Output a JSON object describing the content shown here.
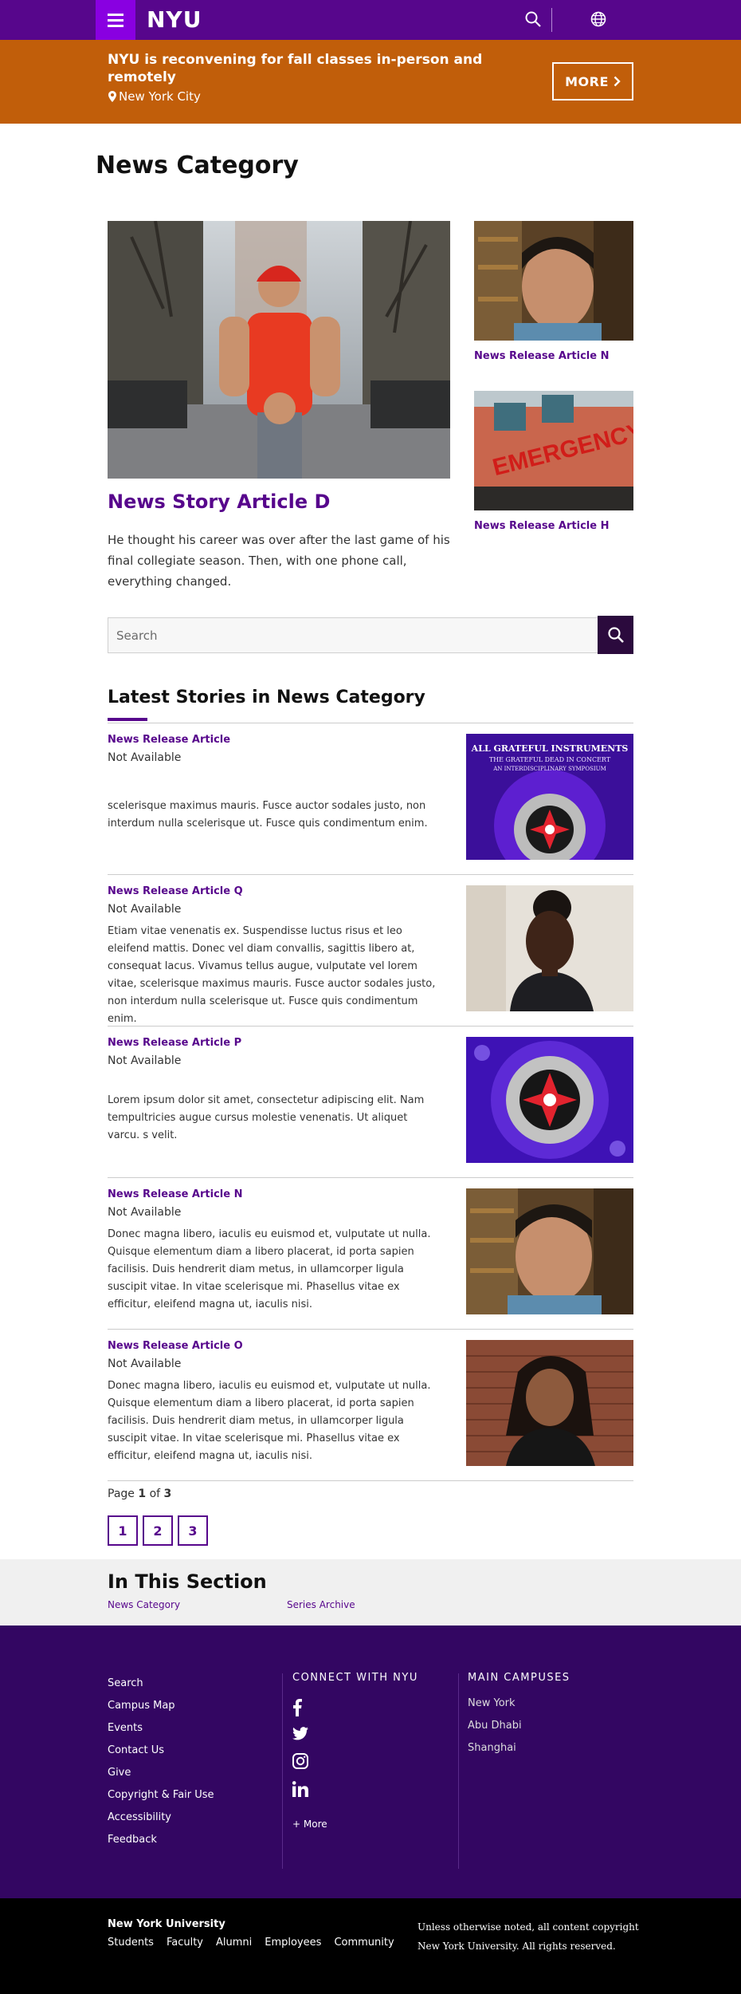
{
  "header": {
    "logo": "NYU",
    "menu_icon": "hamburger-menu-icon",
    "search_icon": "search-icon",
    "globe_icon": "globe-icon",
    "brand_color": "#57068c"
  },
  "alert": {
    "text": "NYU is reconvening for fall classes in-person and remotely",
    "location": "New York City",
    "location_icon": "map-pin-icon",
    "more_label": "MORE",
    "more_icon": "chevron-right-icon",
    "color": "#c15e0a"
  },
  "page": {
    "title": "News Category"
  },
  "featured": {
    "title": "News Story Article D",
    "description": "He thought his career was over after the last game of his final collegiate season. Then, with one phone call, everything changed."
  },
  "side_cards": [
    {
      "label": "News Release Article N"
    },
    {
      "label": "News Release Article H"
    }
  ],
  "search": {
    "placeholder": "Search",
    "button_icon": "search-icon"
  },
  "latest": {
    "heading": "Latest Stories in News Category",
    "stories": [
      {
        "title": "News Release Article",
        "date": "Not Available",
        "description": "scelerisque maximus mauris. Fusce auctor sodales justo, non interdum nulla scelerisque ut. Fusce quis condimentum enim."
      },
      {
        "title": "News Release Article Q",
        "date": "Not Available",
        "description": "Etiam vitae venenatis ex. Suspendisse luctus risus et leo eleifend mattis. Donec vel diam convallis, sagittis libero at, consequat lacus. Vivamus tellus augue, vulputate vel lorem vitae, scelerisque maximus mauris. Fusce auctor sodales justo, non interdum nulla scelerisque ut. Fusce quis condimentum enim."
      },
      {
        "title": "News Release Article P",
        "date": "Not Available",
        "description": "Lorem ipsum dolor sit amet, consectetur adipiscing elit. Nam tempultricies augue cursus molestie venenatis. Ut aliquet varcu. s velit."
      },
      {
        "title": "News Release Article N",
        "date": "Not Available",
        "description": "Donec magna libero, iaculis eu euismod et, vulputate ut nulla. Quisque elementum diam a libero placerat, id porta sapien facilisis. Duis hendrerit diam metus, in ullamcorper ligula suscipit vitae. In vitae scelerisque mi. Phasellus vitae ex efficitur, eleifend magna ut, iaculis nisi."
      },
      {
        "title": "News Release Article O",
        "date": "Not Available",
        "description": "Donec magna libero, iaculis eu euismod et, vulputate ut nulla. Quisque elementum diam a libero placerat, id porta sapien facilisis. Duis hendrerit diam metus, in ullamcorper ligula suscipit vitae. In vitae scelerisque mi. Phasellus vitae ex efficitur, eleifend magna ut, iaculis nisi."
      }
    ],
    "poster_text_1": "ALL GRATEFUL INSTRUMENTS",
    "poster_text_2": "THE GRATEFUL DEAD IN CONCERT",
    "poster_text_3": "AN INTERDISCIPLINARY SYMPOSIUM"
  },
  "emergency_sign": "EMERGENCY",
  "pagination": {
    "page_word": "Page",
    "current": "1",
    "of_word": "of",
    "total": "3",
    "pages": [
      "1",
      "2",
      "3"
    ]
  },
  "in_this_section": {
    "title": "In This Section",
    "links": [
      "News Category",
      "Series Archive"
    ]
  },
  "footer": {
    "links": [
      "Search",
      "Campus Map",
      "Events",
      "Contact Us",
      "Give",
      "Copyright & Fair Use",
      "Accessibility",
      "Feedback"
    ],
    "connect_heading": "CONNECT WITH NYU",
    "social_icons": [
      "facebook-icon",
      "twitter-icon",
      "instagram-icon",
      "linkedin-icon"
    ],
    "more_label": "+ More",
    "campuses_heading": "MAIN CAMPUSES",
    "campuses": [
      "New York",
      "Abu Dhabi",
      "Shanghai"
    ]
  },
  "bottom": {
    "title": "New York University",
    "links": [
      "Students",
      "Faculty",
      "Alumni",
      "Employees",
      "Community"
    ],
    "copyright": "Unless otherwise noted, all content copyright New York University. All rights reserved."
  }
}
